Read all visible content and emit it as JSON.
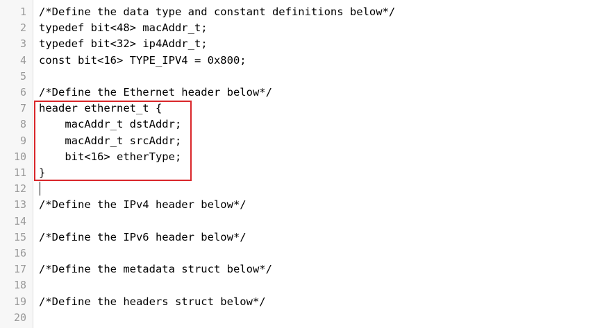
{
  "editor": {
    "lines": [
      {
        "number": "1",
        "code": "/*Define the data type and constant definitions below*/"
      },
      {
        "number": "2",
        "code": "typedef bit<48> macAddr_t;"
      },
      {
        "number": "3",
        "code": "typedef bit<32> ip4Addr_t;"
      },
      {
        "number": "4",
        "code": "const bit<16> TYPE_IPV4 = 0x800;"
      },
      {
        "number": "5",
        "code": ""
      },
      {
        "number": "6",
        "code": "/*Define the Ethernet header below*/"
      },
      {
        "number": "7",
        "code": "header ethernet_t {"
      },
      {
        "number": "8",
        "code": "    macAddr_t dstAddr;"
      },
      {
        "number": "9",
        "code": "    macAddr_t srcAddr;"
      },
      {
        "number": "10",
        "code": "    bit<16> etherType;"
      },
      {
        "number": "11",
        "code": "}"
      },
      {
        "number": "12",
        "code": ""
      },
      {
        "number": "13",
        "code": "/*Define the IPv4 header below*/"
      },
      {
        "number": "14",
        "code": ""
      },
      {
        "number": "15",
        "code": "/*Define the IPv6 header below*/"
      },
      {
        "number": "16",
        "code": ""
      },
      {
        "number": "17",
        "code": "/*Define the metadata struct below*/"
      },
      {
        "number": "18",
        "code": ""
      },
      {
        "number": "19",
        "code": "/*Define the headers struct below*/"
      },
      {
        "number": "20",
        "code": ""
      }
    ]
  },
  "colors": {
    "highlight_border": "#d9262a",
    "line_number": "#999999",
    "gutter_background": "#f7f7f7"
  }
}
